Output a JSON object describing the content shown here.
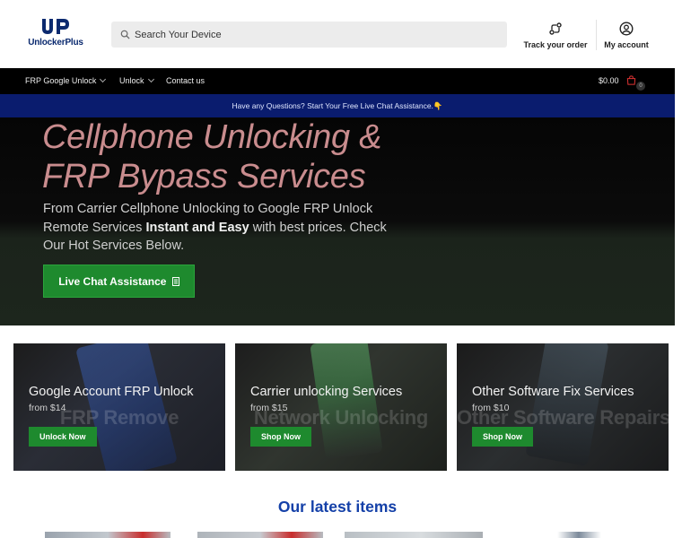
{
  "brand": {
    "logo_text_main": "Unlocker",
    "logo_text_plus": "Plus",
    "color": "#0b2a6f"
  },
  "search": {
    "placeholder": "Search Your Device",
    "value": ""
  },
  "header": {
    "track_label": "Track your order",
    "account_label": "My account",
    "track_icon": "route-icon",
    "account_icon": "user-icon"
  },
  "nav": {
    "items": [
      {
        "label": "FRP Google Unlock",
        "has_dropdown": true
      },
      {
        "label": "Unlock",
        "has_dropdown": true
      },
      {
        "label": "Contact us",
        "has_dropdown": false
      }
    ],
    "cart_total": "$0.00",
    "cart_count": "0",
    "cart_icon": "shopping-bag-icon"
  },
  "banner": {
    "text": "Have any Questions? Start Your Free Live Chat Assistance.👇",
    "bg_color": "#0a1c6e"
  },
  "hero": {
    "title_line1": "Cellphone Unlocking &",
    "title_line2": "FRP Bypass Services",
    "desc_part1": "From Carrier Cellphone Unlocking to Google FRP Unlock Remote Services ",
    "desc_strong": "Instant and Easy",
    "desc_part2": " with best prices. Check Our Hot Services Below.",
    "button_label": "Live Chat Assistance",
    "title_color": "#c98c8e",
    "button_color": "#1e8a2e"
  },
  "cards": [
    {
      "title": "Google Account FRP Unlock",
      "price": "from $14",
      "button": "Unlock Now",
      "watermark": "FRP Remove"
    },
    {
      "title": "Carrier unlocking Services",
      "price": "from $15",
      "button": "Shop Now",
      "watermark": "Network Unlocking"
    },
    {
      "title": "Other Software Fix Services",
      "price": "from $10",
      "button": "Shop Now",
      "watermark": "Other Software Repairs"
    }
  ],
  "latest": {
    "title": "Our latest items",
    "title_color": "#1440a8"
  }
}
